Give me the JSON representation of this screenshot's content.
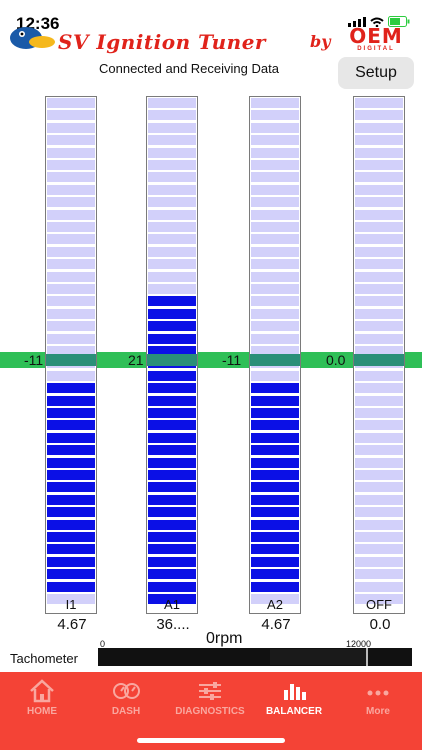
{
  "status_bar": {
    "time": "12:36"
  },
  "header": {
    "title": "SV Ignition Tuner",
    "by": "by",
    "brand": "OEM",
    "brand_sub": "DIGITAL"
  },
  "connection_status": "Connected and Receiving Data",
  "setup_label": "Setup",
  "columns": [
    {
      "label": "I1",
      "value": "4.67",
      "offset_label": "-11",
      "fill_from": "zero-down",
      "level_percent": 42
    },
    {
      "label": "A1",
      "value": "36....",
      "offset_label": "21",
      "fill_from": "up",
      "level_percent": 60
    },
    {
      "label": "A2",
      "value": "4.67",
      "offset_label": "-11",
      "fill_from": "zero-down",
      "level_percent": 42
    },
    {
      "label": "OFF",
      "value": "0.0",
      "offset_label": "0.0",
      "fill_from": "none",
      "level_percent": 0
    }
  ],
  "rpm": {
    "value": "0rpm",
    "min": "0",
    "max": "12000",
    "level": 0
  },
  "tachometer_label": "Tachometer",
  "tabs": [
    {
      "label": "HOME",
      "icon": "home-icon",
      "active": false
    },
    {
      "label": "DASH",
      "icon": "dash-icon",
      "active": false
    },
    {
      "label": "DIAGNOSTICS",
      "icon": "sliders-icon",
      "active": false
    },
    {
      "label": "BALANCER",
      "icon": "bars-icon",
      "active": true
    },
    {
      "label": "More",
      "icon": "more-icon",
      "active": false
    }
  ],
  "colors": {
    "accent": "#f44336",
    "fill": "#0b10e6",
    "empty": "#d2d0fa",
    "zero_band": "#2fbf57"
  }
}
